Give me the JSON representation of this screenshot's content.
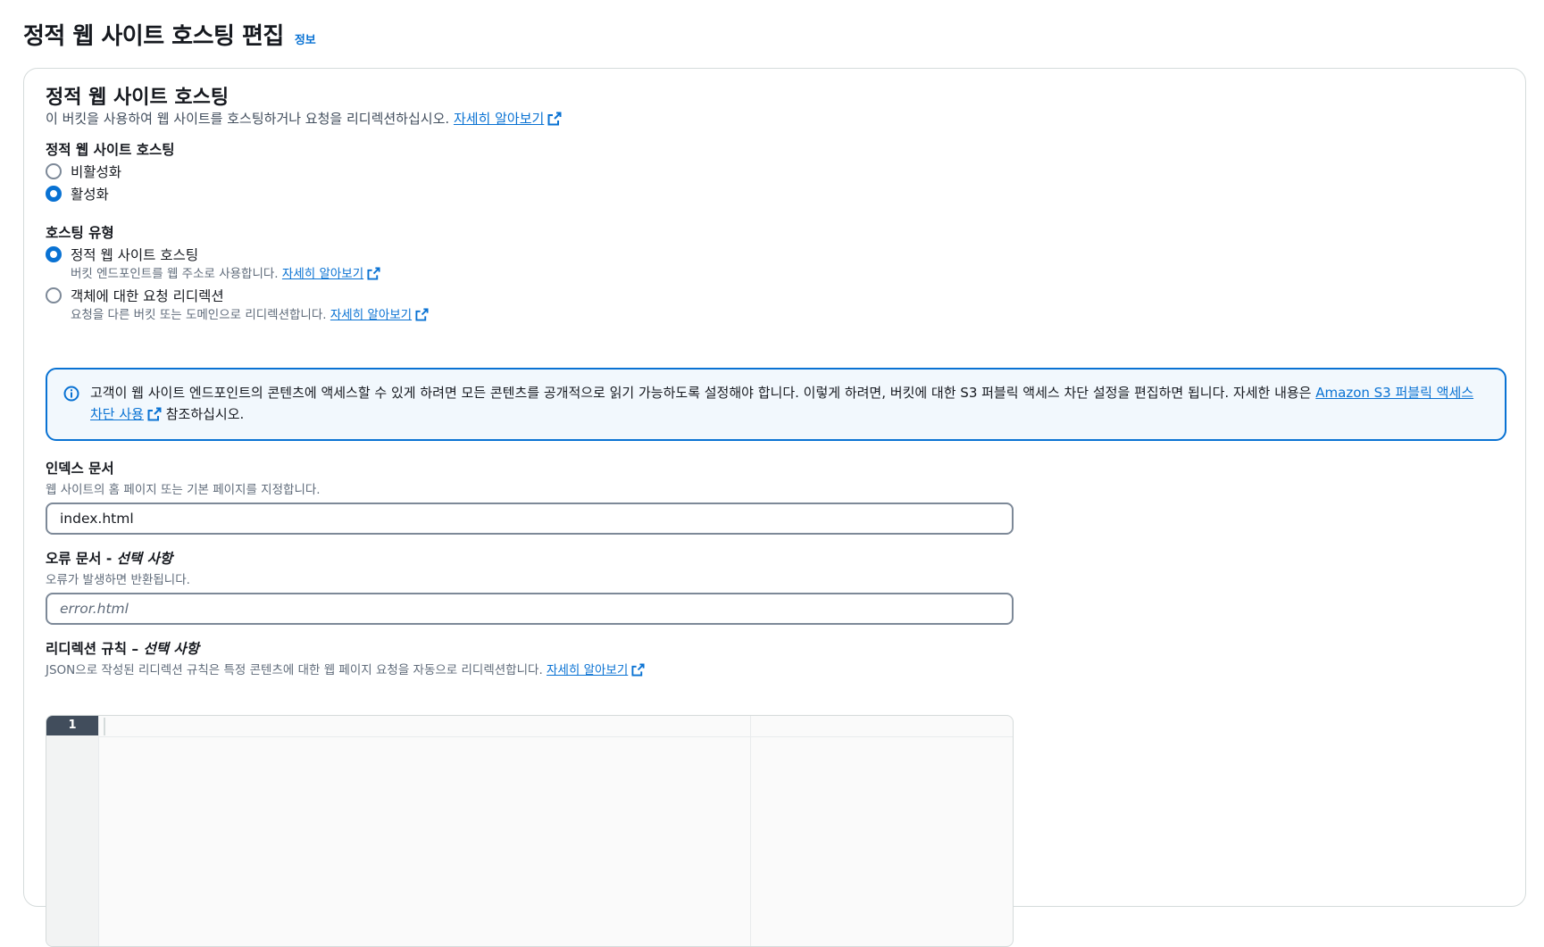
{
  "header": {
    "title": "정적 웹 사이트 호스팅 편집",
    "info": "정보"
  },
  "section": {
    "title": "정적 웹 사이트 호스팅",
    "description": "이 버킷을 사용하여 웹 사이트를 호스팅하거나 요청을 리디렉션하십시오.",
    "learn_more": "자세히 알아보기"
  },
  "hosting": {
    "label": "정적 웹 사이트 호스팅",
    "options": [
      {
        "label": "비활성화",
        "selected": false
      },
      {
        "label": "활성화",
        "selected": true
      }
    ]
  },
  "hosting_type": {
    "label": "호스팅 유형",
    "options": [
      {
        "label": "정적 웹 사이트 호스팅",
        "description": "버킷 엔드포인트를 웹 주소로 사용합니다.",
        "learn_more": "자세히 알아보기",
        "selected": true
      },
      {
        "label": "객체에 대한 요청 리디렉션",
        "description": "요청을 다른 버킷 또는 도메인으로 리디렉션합니다.",
        "learn_more": "자세히 알아보기",
        "selected": false
      }
    ]
  },
  "alert": {
    "text_before": "고객이 웹 사이트 엔드포인트의 콘텐츠에 액세스할 수 있게 하려면 모든 콘텐츠를 공개적으로 읽기 가능하도록 설정해야 합니다. 이렇게 하려면, 버킷에 대한 S3 퍼블릭 액세스 차단 설정을 편집하면 됩니다. 자세한 내용은 ",
    "link": "Amazon S3 퍼블릭 액세스 차단 사용",
    "text_after": " 참조하십시오."
  },
  "index_document": {
    "label": "인덱스 문서",
    "description": "웹 사이트의 홈 페이지 또는 기본 페이지를 지정합니다.",
    "value": "index.html"
  },
  "error_document": {
    "label": "오류 문서 - ",
    "label_optional": "선택 사항",
    "description": "오류가 발생하면 반환됩니다.",
    "placeholder": "error.html"
  },
  "redirection_rules": {
    "label": "리디렉션 규칙 – ",
    "label_optional": "선택 사항",
    "description": "JSON으로 작성된 리디렉션 규칙은 특정 콘텐츠에 대한 웹 페이지 요청을 자동으로 리디렉션합니다.",
    "learn_more": "자세히 알아보기",
    "line_number": "1"
  }
}
